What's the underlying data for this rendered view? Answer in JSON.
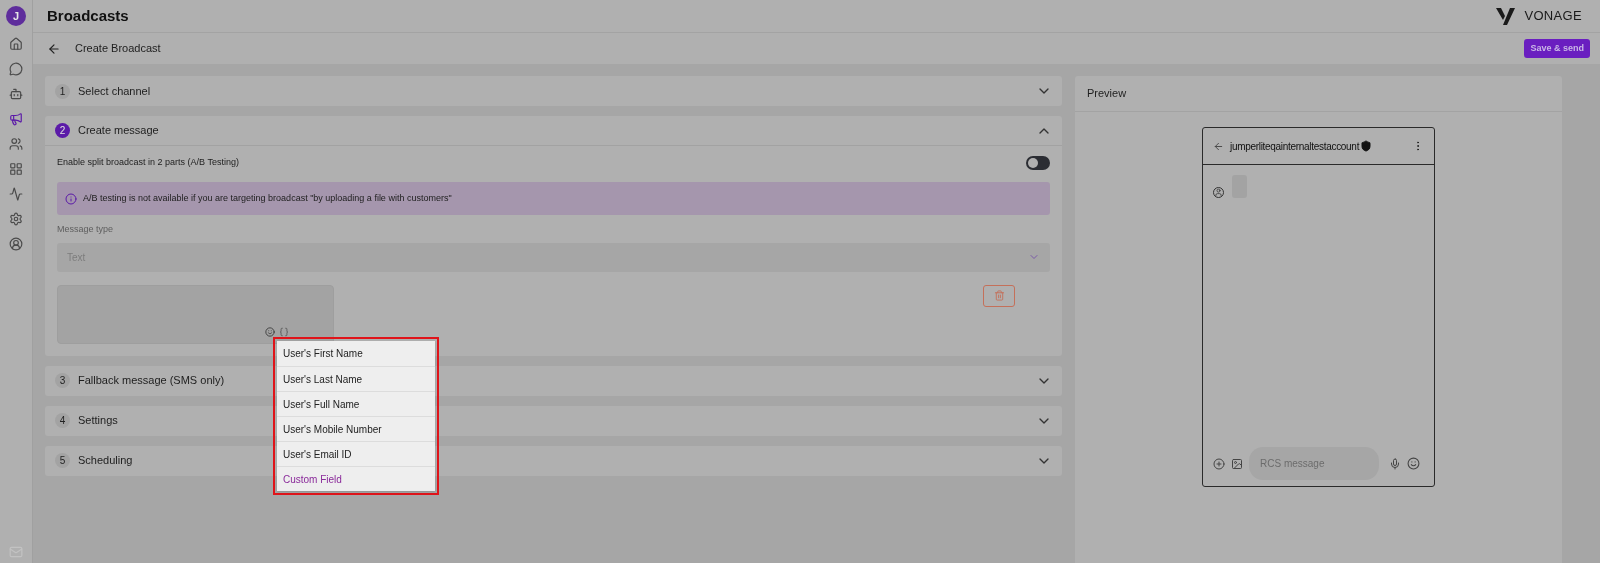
{
  "app_header": {
    "title": "Broadcasts",
    "logo_text": "VONAGE"
  },
  "sidebar": {
    "logo_letter": "J",
    "items": [
      {
        "kind": "home",
        "selected": false
      },
      {
        "kind": "chat",
        "selected": false
      },
      {
        "kind": "bot",
        "selected": false
      },
      {
        "kind": "megaphone",
        "selected": true
      },
      {
        "kind": "users",
        "selected": false
      },
      {
        "kind": "apps",
        "selected": false
      },
      {
        "kind": "analytics",
        "selected": false
      },
      {
        "kind": "settings",
        "selected": false
      },
      {
        "kind": "profile",
        "selected": false
      }
    ]
  },
  "subheader": {
    "title": "Create Broadcast",
    "primary_button": "Save & send"
  },
  "steps": [
    {
      "number": "1",
      "title": "Select channel",
      "expanded": false,
      "active": false
    },
    {
      "number": "2",
      "title": "Create message",
      "expanded": true,
      "active": true
    },
    {
      "number": "3",
      "title": "Fallback message (SMS only)",
      "expanded": false,
      "active": false
    },
    {
      "number": "4",
      "title": "Settings",
      "expanded": false,
      "active": false
    },
    {
      "number": "5",
      "title": "Scheduling",
      "expanded": false,
      "active": false
    }
  ],
  "create_message": {
    "split_label": "Enable split broadcast in 2 parts (A/B Testing)",
    "split_on": false,
    "info": "A/B testing is not available if you are targeting broadcast \"by uploading a file with customers\"",
    "message_type_label": "Message type",
    "message_type_value": "Text"
  },
  "variables_menu": [
    {
      "label": "User's First Name",
      "kind": "field"
    },
    {
      "label": "User's Last Name",
      "kind": "field"
    },
    {
      "label": "User's Full Name",
      "kind": "field"
    },
    {
      "label": "User's Mobile Number",
      "kind": "field"
    },
    {
      "label": "User's Email ID",
      "kind": "field"
    },
    {
      "label": "Custom Field",
      "kind": "custom"
    }
  ],
  "preview": {
    "title": "Preview",
    "account": "jumperliteqainternaltestaccount",
    "input_placeholder": "RCS message"
  }
}
